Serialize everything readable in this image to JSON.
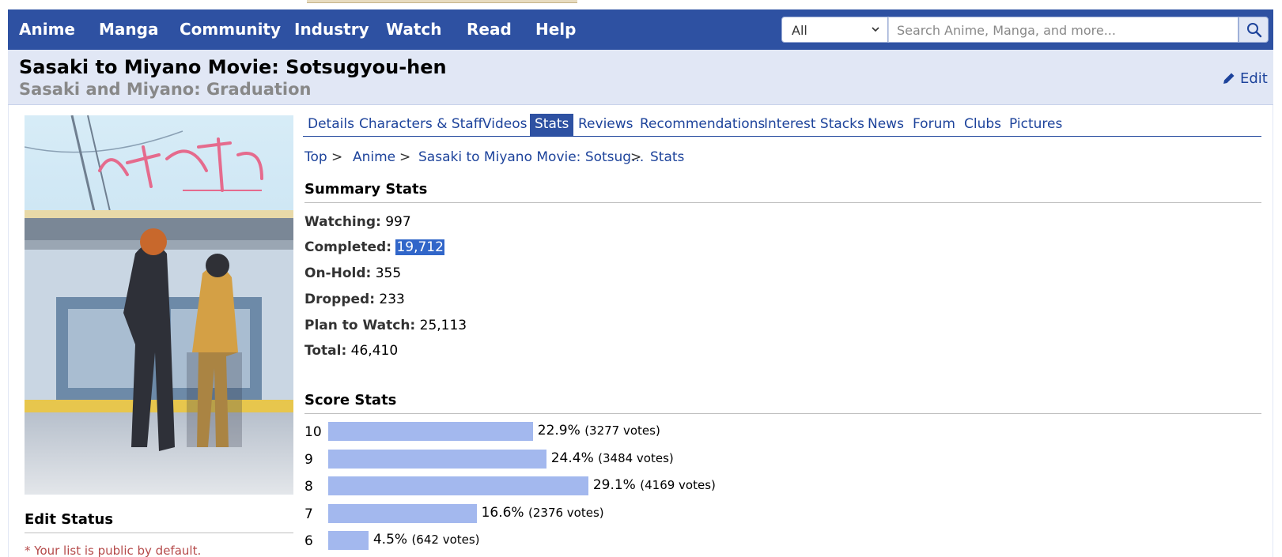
{
  "nav": {
    "menu": [
      "Anime",
      "Manga",
      "Community",
      "Industry",
      "Watch",
      "Read",
      "Help"
    ],
    "search_scope": "All",
    "search_placeholder": "Search Anime, Manga, and more..."
  },
  "title": {
    "main": "Sasaki to Miyano Movie: Sotsugyou-hen",
    "english": "Sasaki and Miyano: Graduation",
    "edit_label": "Edit"
  },
  "tabs": [
    {
      "label": "Details"
    },
    {
      "label": "Characters & Staff"
    },
    {
      "label": "Videos"
    },
    {
      "label": "Stats",
      "active": true
    },
    {
      "label": "Reviews"
    },
    {
      "label": "Recommendations"
    },
    {
      "label": "Interest Stacks"
    },
    {
      "label": "News"
    },
    {
      "label": "Forum"
    },
    {
      "label": "Clubs"
    },
    {
      "label": "Pictures"
    }
  ],
  "breadcrumb": {
    "items": [
      "Top",
      "Anime",
      "Sasaki to Miyano Movie: Sotsug...",
      "Stats"
    ],
    "separator": ">"
  },
  "summary": {
    "title": "Summary Stats",
    "rows": [
      {
        "label": "Watching:",
        "value": "997"
      },
      {
        "label": "Completed:",
        "value": "19,712",
        "selected": true
      },
      {
        "label": "On-Hold:",
        "value": "355"
      },
      {
        "label": "Dropped:",
        "value": "233"
      },
      {
        "label": "Plan to Watch:",
        "value": "25,113"
      },
      {
        "label": "Total:",
        "value": "46,410"
      }
    ]
  },
  "score_stats": {
    "title": "Score Stats",
    "rows": [
      {
        "score": "10",
        "percent": 22.9,
        "percent_label": "22.9%",
        "votes": "(3277 votes)"
      },
      {
        "score": "9",
        "percent": 24.4,
        "percent_label": "24.4%",
        "votes": "(3484 votes)"
      },
      {
        "score": "8",
        "percent": 29.1,
        "percent_label": "29.1%",
        "votes": "(4169 votes)"
      },
      {
        "score": "7",
        "percent": 16.6,
        "percent_label": "16.6%",
        "votes": "(2376 votes)"
      },
      {
        "score": "6",
        "percent": 4.5,
        "percent_label": "4.5%",
        "votes": "(642 votes)"
      }
    ]
  },
  "sidebar": {
    "edit_status_title": "Edit Status",
    "public_note": "* Your list is public by default."
  },
  "colors": {
    "brand": "#2e51a2",
    "title_band": "#e1e7f5",
    "link": "#1d439b",
    "score_bar": "#a3b8ee",
    "selection": "#3166c9",
    "note_red": "#b54a4a"
  }
}
